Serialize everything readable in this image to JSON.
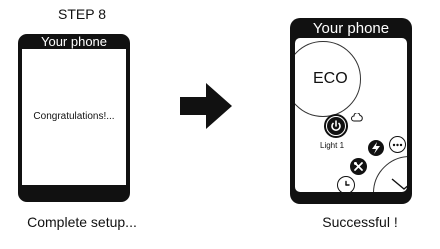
{
  "left_panel": {
    "step_title": "STEP 8",
    "phone_title": "Your phone",
    "message": "Congratulations!...",
    "caption": "Complete setup..."
  },
  "arrow": {
    "icon": "right-arrow-icon"
  },
  "right_panel": {
    "phone_title": "Your phone",
    "mode_label": "ECO",
    "device_label": "Light 1",
    "caption": "Successful !",
    "icons": [
      "power-icon",
      "cloud-icon",
      "bolt-icon",
      "more-icon",
      "tools-icon",
      "clock-icon",
      "chevron-down-icon"
    ]
  },
  "colors": {
    "phone_frame": "#111111",
    "screen": "#ffffff",
    "accent": "#111111"
  }
}
